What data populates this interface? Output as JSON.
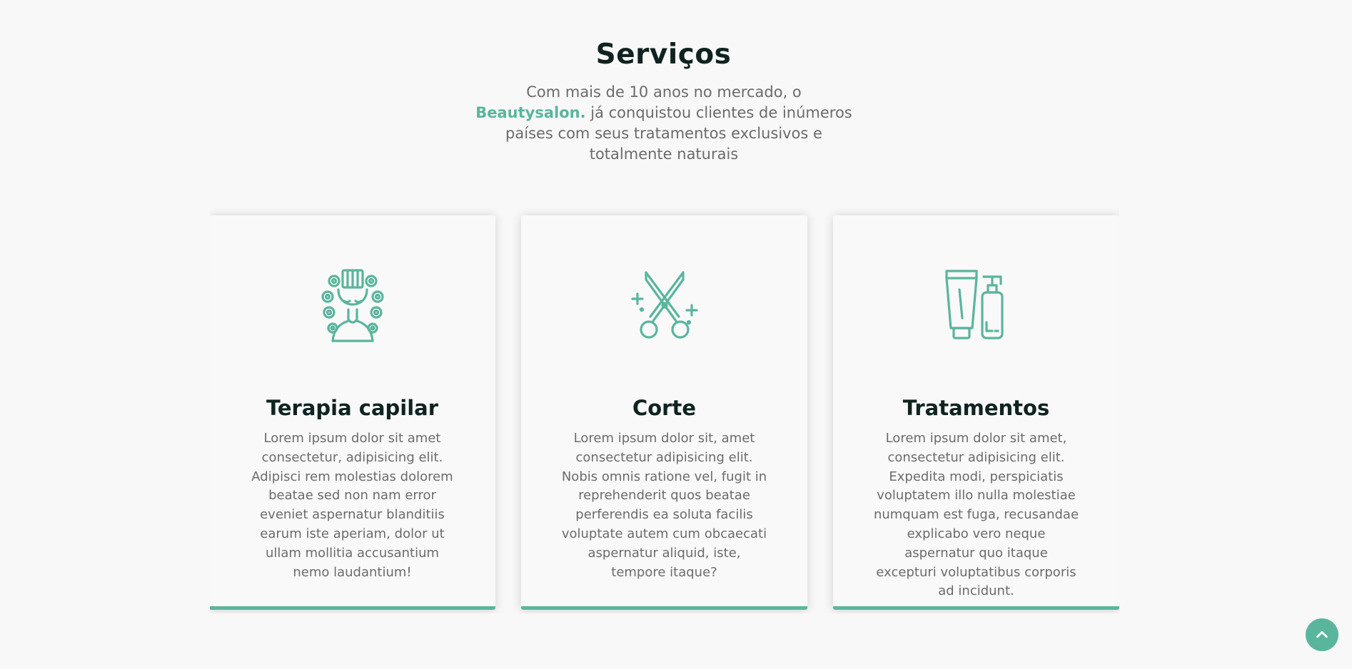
{
  "section": {
    "title": "Serviços",
    "intro_before": "Com mais de 10 anos no mercado, o ",
    "intro_brand": "Beautysalon.",
    "intro_after": " já conquistou clientes de inúmeros países com seus tratamentos exclusivos e totalmente naturais"
  },
  "cards": [
    {
      "icon": "hair-rollers-icon",
      "title": "Terapia capilar",
      "text": "Lorem ipsum dolor sit amet consectetur, adipisicing elit. Adipisci rem molestias dolorem beatae sed non nam error eveniet aspernatur blanditiis earum iste aperiam, dolor ut ullam mollitia accusantium nemo laudantium!"
    },
    {
      "icon": "scissors-icon",
      "title": "Corte",
      "text": "Lorem ipsum dolor sit, amet consectetur adipisicing elit. Nobis omnis ratione vel, fugit in reprehenderit quos beatae perferendis ea soluta facilis voluptate autem cum obcaecati aspernatur aliquid, iste, tempore itaque?"
    },
    {
      "icon": "cosmetic-bottles-icon",
      "title": "Tratamentos",
      "text": "Lorem ipsum dolor sit amet, consectetur adipisicing elit. Expedita modi, perspiciatis voluptatem illo nulla molestiae numquam est fuga, recusandae explicabo vero neque aspernatur quo itaque excepturi voluptatibus corporis ad incidunt."
    }
  ],
  "colors": {
    "accent": "#5ab59d",
    "heading": "#0f2320",
    "text": "#6b6b6b",
    "background": "#f8f8f8"
  },
  "scroll_top_icon": "chevron-up-icon"
}
